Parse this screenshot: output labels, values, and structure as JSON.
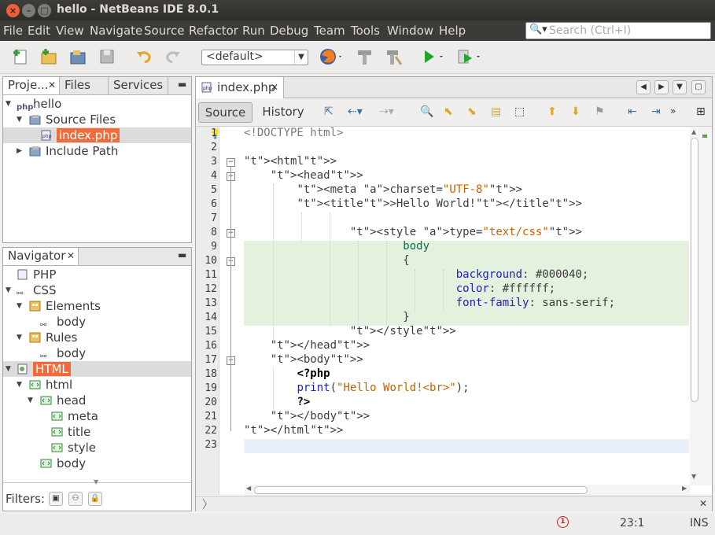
{
  "window": {
    "title": "hello - NetBeans IDE 8.0.1"
  },
  "menu": [
    "File",
    "Edit",
    "View",
    "Navigate",
    "Source",
    "Refactor",
    "Run",
    "Debug",
    "Team",
    "Tools",
    "Window",
    "Help"
  ],
  "search": {
    "placeholder": "Search (Ctrl+I)"
  },
  "toolbar": {
    "config_value": "<default>"
  },
  "projects_panel": {
    "tabs": [
      "Proje...",
      "Files",
      "Services"
    ],
    "tree": [
      {
        "label": "hello",
        "depth": 0,
        "icon": "php-project-icon"
      },
      {
        "label": "Source Files",
        "depth": 1,
        "icon": "source-folder-icon"
      },
      {
        "label": "index.php",
        "depth": 2,
        "icon": "php-file-icon",
        "selected": true
      },
      {
        "label": "Include Path",
        "depth": 1,
        "icon": "include-path-icon"
      }
    ]
  },
  "navigator": {
    "title": "Navigator",
    "tree": [
      {
        "label": "PHP",
        "depth": 0
      },
      {
        "label": "CSS",
        "depth": 0
      },
      {
        "label": "Elements",
        "depth": 1
      },
      {
        "label": "body",
        "depth": 2
      },
      {
        "label": "Rules",
        "depth": 1
      },
      {
        "label": "body",
        "depth": 2
      },
      {
        "label": "HTML",
        "depth": 0,
        "selected": true
      },
      {
        "label": "html",
        "depth": 1
      },
      {
        "label": "head",
        "depth": 2
      },
      {
        "label": "meta",
        "depth": 3
      },
      {
        "label": "title",
        "depth": 3
      },
      {
        "label": "style",
        "depth": 3
      },
      {
        "label": "body",
        "depth": 2
      }
    ],
    "filters_label": "Filters:"
  },
  "editor": {
    "file_tab": "index.php",
    "source_tab": "Source",
    "history_tab": "History",
    "line_numbers": [
      "1",
      "2",
      "3",
      "4",
      "5",
      "6",
      "7",
      "8",
      "9",
      "10",
      "11",
      "12",
      "13",
      "14",
      "15",
      "16",
      "17",
      "18",
      "19",
      "20",
      "21",
      "22",
      "23"
    ],
    "lines": [
      "<!DOCTYPE html>",
      "",
      "<html>",
      "    <head>",
      "        <meta charset=\"UTF-8\">",
      "        <title>Hello World!</title>",
      "",
      "                <style type=\"text/css\">",
      "                        body",
      "                        {",
      "                                background: #000040;",
      "                                color: #ffffff;",
      "                                font-family: sans-serif;",
      "                        }",
      "                </style>",
      "    </head>",
      "    <body>",
      "        <?php",
      "        print(\"Hello World!<br>\");",
      "        ?>",
      "    </body>",
      "</html>",
      ""
    ]
  },
  "status": {
    "position": "23:1",
    "mode": "INS",
    "notifications": "1"
  },
  "colors": {
    "accent": "#f26b3a",
    "highlight": "#e4f1de",
    "current_line": "#e8f0fa"
  }
}
